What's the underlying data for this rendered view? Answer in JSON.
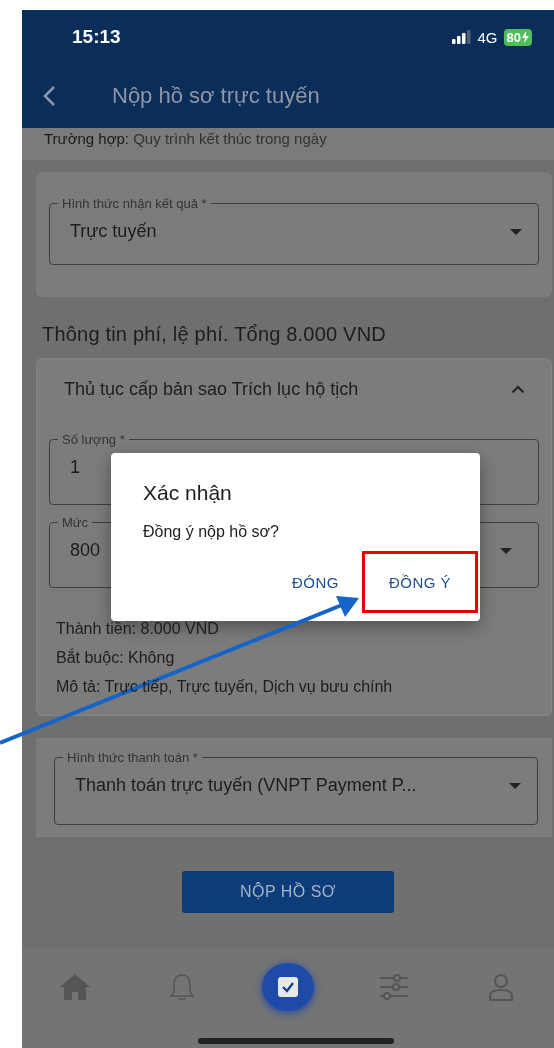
{
  "status_bar": {
    "time": "15:13",
    "network": "4G",
    "battery": "80"
  },
  "header": {
    "title": "Nộp hồ sơ trực tuyến"
  },
  "case": {
    "label": "Trường hợp:",
    "value": "Quy trình kết thúc trong ngày"
  },
  "receive_field": {
    "label": "Hình thức nhận kết quả *",
    "value": "Trực tuyến"
  },
  "fees": {
    "title": "Thông tin phí, lệ phí. Tổng 8.000 VND",
    "procedure": {
      "title": "Thủ tục cấp bản sao Trích lục hộ tịch",
      "expanded": true,
      "fields": [
        {
          "label": "Số lượng *",
          "value": "1",
          "kind": "text"
        },
        {
          "label": "Mức",
          "value": "800",
          "kind": "select"
        }
      ],
      "details": [
        "Thành tiền: 8.000 VND",
        "Bắt buộc: Không",
        "Mô tả: Trực tiếp, Trực tuyến, Dịch vụ bưu chính"
      ]
    }
  },
  "payment_field": {
    "label": "Hình thức thanh toán *",
    "value": "Thanh toán trực tuyến (VNPT Payment P..."
  },
  "submit_button": "NỘP HỒ SƠ",
  "nav": [
    {
      "selected": false
    },
    {
      "selected": false
    },
    {
      "selected": true
    },
    {
      "selected": false
    },
    {
      "selected": false
    }
  ],
  "dialog": {
    "title": "Xác nhận",
    "message": "Đồng ý nộp hồ sơ?",
    "buttons": [
      {
        "label": "ĐÓNG",
        "highlighted": false
      },
      {
        "label": "ĐỒNG Ý",
        "highlighted": true
      }
    ]
  }
}
